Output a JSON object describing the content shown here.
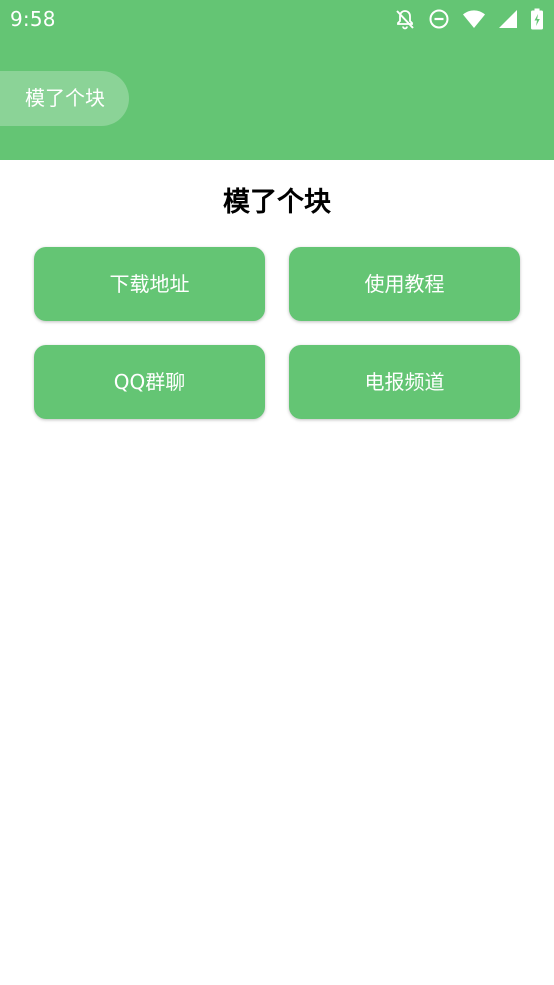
{
  "status_bar": {
    "time": "9:58",
    "icons": [
      "notifications-off-icon",
      "do-not-disturb-icon",
      "wifi-icon",
      "cellular-signal-icon",
      "battery-charging-icon"
    ]
  },
  "toolbar": {
    "app_name": "模了个块"
  },
  "main": {
    "title": "模了个块",
    "buttons": [
      {
        "label": "下载地址"
      },
      {
        "label": "使用教程"
      },
      {
        "label": "QQ群聊"
      },
      {
        "label": "电报频道"
      }
    ]
  },
  "colors": {
    "accent": "#64c574",
    "background": "#ffffff",
    "title_text": "#000000"
  }
}
